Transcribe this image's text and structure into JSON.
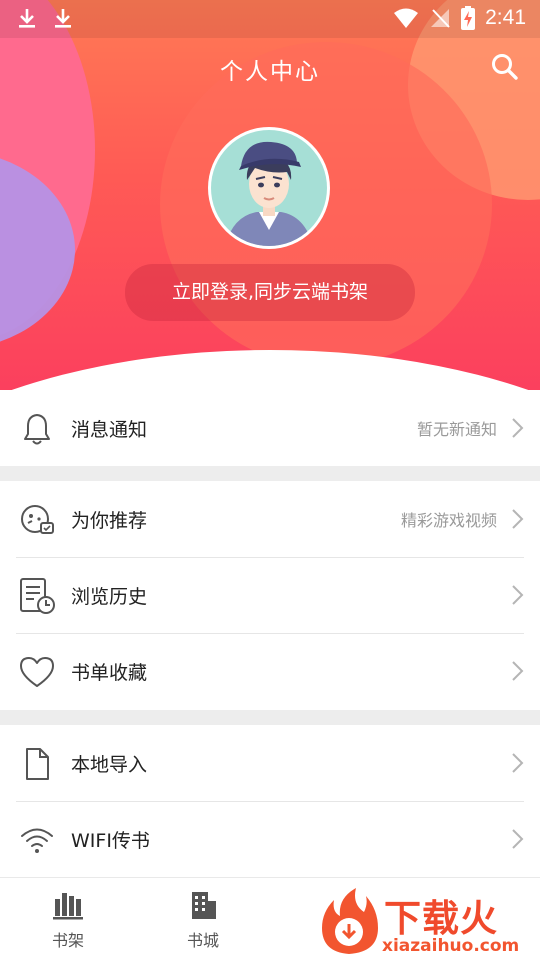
{
  "status_bar": {
    "time": "2:41",
    "icons": [
      "download-icon",
      "download-icon",
      "wifi-icon",
      "no-signal-icon",
      "battery-charging-icon"
    ]
  },
  "header": {
    "title": "个人中心",
    "search_icon": "search-icon",
    "avatar_icon": "avatar",
    "login_label": "立即登录,同步云端书架"
  },
  "menu": {
    "notifications": {
      "label": "消息通知",
      "value": "暂无新通知",
      "icon": "bell-icon"
    },
    "recommend": {
      "label": "为你推荐",
      "value": "精彩游戏视频",
      "icon": "game-recommend-icon"
    },
    "history": {
      "label": "浏览历史",
      "icon": "history-document-icon"
    },
    "favorites": {
      "label": "书单收藏",
      "icon": "heart-icon"
    },
    "local_import": {
      "label": "本地导入",
      "icon": "file-icon"
    },
    "wifi_transfer": {
      "label": "WIFI传书",
      "icon": "wifi-icon"
    }
  },
  "bottom_nav": {
    "items": [
      {
        "label": "书架",
        "icon": "bookshelf-icon"
      },
      {
        "label": "书城",
        "icon": "bookstore-icon"
      }
    ]
  },
  "watermark": {
    "text": "下载火",
    "url": "xiazaihuo.com"
  },
  "colors": {
    "header_top": "#ff7a55",
    "header_bottom": "#fb3f5e",
    "accent_pink": "#ff6a8e",
    "accent_purple": "#b692e6",
    "watermark": "#f04a2c"
  }
}
